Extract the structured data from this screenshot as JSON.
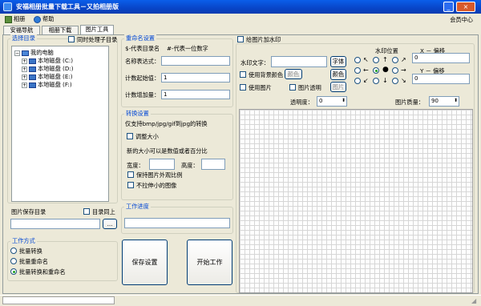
{
  "window": {
    "title": "安福相册批量下载工具－又拍相册版"
  },
  "menu": {
    "album": "相册",
    "help": "帮助"
  },
  "member_center": "会员中心",
  "tabs": [
    "安福导航",
    "相册下载",
    "图片工具"
  ],
  "dir_select": {
    "title": "选择目录",
    "also_sub": "同时处理子目录",
    "tree": {
      "root": "我的电脑",
      "drives": [
        "本地磁盘 (C:)",
        "本地磁盘 (D:)",
        "本地磁盘 (E:)",
        "本地磁盘 (F:)"
      ]
    }
  },
  "save_dir": {
    "label": "图片保存目录",
    "same_level": "目录同上",
    "browse": "..."
  },
  "work_mode": {
    "title": "工作方式",
    "options": [
      "批量转换",
      "批量重命名",
      "批量转换和重命名"
    ]
  },
  "rename": {
    "title": "重命名设置",
    "hint1": "$-代表目录名",
    "hint2": "#-代表一位数字",
    "expr_label": "名称表达式：",
    "start_label": "计数起始值：",
    "start_value": "1",
    "step_label": "计数增加量：",
    "step_value": "1"
  },
  "convert": {
    "title": "转换设置",
    "support": "仅支持bmp/jpg/gif到jpg的转换",
    "resize": "调整大小",
    "size_hint": "新的大小可以是数值或者百分比",
    "width_label": "宽度：",
    "height_label": "高度：",
    "keep_ratio": "保持图片外观比例",
    "no_stretch": "不拉伸小的图像"
  },
  "progress": {
    "title": "工作进度"
  },
  "buttons": {
    "save": "保存设置",
    "start": "开始工作"
  },
  "watermark": {
    "title": "给图片加水印",
    "text_label": "水印文字：",
    "font_btn": "字体",
    "use_bg": "使用背景颜色",
    "bg_btn": "颜色",
    "color_btn": "颜色",
    "use_image": "使用图片",
    "image_transparent": "图片透明",
    "image_btn": "图片",
    "position_title": "水印位置",
    "x_offset": "X － 偏移",
    "x_value": "0",
    "y_offset": "Y － 偏移",
    "y_value": "0",
    "opacity_label": "透明度：",
    "opacity_value": "0",
    "quality_label": "图片质量：",
    "quality_value": "90"
  }
}
